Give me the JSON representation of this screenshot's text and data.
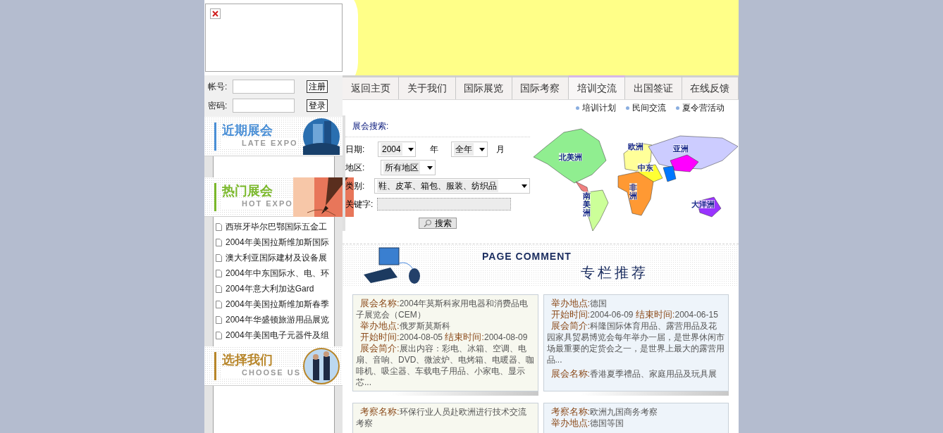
{
  "login": {
    "fields": [
      {
        "label": "帐号:",
        "button": "注册"
      },
      {
        "label": "密码:",
        "button": "登录"
      }
    ]
  },
  "nav": {
    "tabs": [
      {
        "label": "返回主页",
        "selected": false
      },
      {
        "label": "关于我们",
        "selected": false
      },
      {
        "label": "国际展览",
        "selected": false
      },
      {
        "label": "国际考察",
        "selected": false
      },
      {
        "label": "培训交流",
        "selected": true
      },
      {
        "label": "出国签证",
        "selected": false
      },
      {
        "label": "在线反馈",
        "selected": false
      }
    ],
    "subnav": [
      "培训计划",
      "民间交流",
      "夏令营活动"
    ]
  },
  "sidebar": {
    "sections": [
      {
        "title": "近期展会",
        "subtitle": "LATE EXPO",
        "color": "#4a8fd6"
      },
      {
        "title": "热门展会",
        "subtitle": "HOT EXPO",
        "color": "#7ab82a",
        "items": [
          "西班牙毕尔巴鄂国际五金工",
          "2004年美国拉斯维加斯国际",
          "澳大利亚国际建材及设备展",
          "2004年中东国际水、电、环",
          "2004年意大利加达Gard",
          "2004年美国拉斯维加斯春季",
          "2004年华盛顿旅游用品展览",
          "2004年美国电子元器件及组"
        ]
      },
      {
        "title": "选择我们",
        "subtitle": "CHOOSE US",
        "color": "#b8862a"
      }
    ]
  },
  "search": {
    "title": "展会搜索:",
    "date_label": "日期:",
    "year": "2004",
    "year_unit": "年",
    "month": "全年",
    "month_unit": "月",
    "region_label": "地区:",
    "region": "所有地区",
    "category_label": "类别:",
    "category": "鞋、皮革、箱包、服装、纺织品",
    "keyword_label": "关键字:",
    "button": "搜索"
  },
  "map": {
    "regions": [
      {
        "label": "北美洲",
        "color": "#90ee90",
        "kind": "horizontal"
      },
      {
        "label": "南美洲",
        "color": "#ccff99",
        "kind": "vertical"
      },
      {
        "label": "欧洲",
        "color": "#ffff99",
        "kind": "horizontal"
      },
      {
        "label": "亚洲",
        "color": "#ccccff",
        "kind": "horizontal"
      },
      {
        "label": "中东",
        "color": "#ffff33",
        "kind": "horizontal"
      },
      {
        "label": "非洲",
        "color": "#ff9933",
        "kind": "vertical"
      },
      {
        "label": "大洋洲",
        "color": "#9933ff",
        "kind": "horizontal"
      }
    ]
  },
  "banner": {
    "title": "PAGE COMMENT",
    "subtitle": "专栏推荐"
  },
  "cards": [
    {
      "entries": [
        {
          "lines": [
            [
              {
                "label": "展会名称:",
                "value": "2004年莫斯科家用电器和消费品电子展览会（CEM）"
              }
            ],
            [
              {
                "label": "举办地点:",
                "value": "俄罗斯莫斯科"
              }
            ],
            [
              {
                "label": "开始时间:",
                "value": "2004-08-05"
              },
              {
                "label": "结束时间:",
                "value": "2004-08-09"
              }
            ],
            [
              {
                "label": "展会简介:",
                "value": "展出内容：彩电、冰箱、空调、电扇、音响、DVD、微波炉、电烤箱、电暖器、咖啡机、吸尘器、车载电子用品、小家电、显示芯..."
              }
            ]
          ]
        }
      ]
    },
    {
      "entries": [
        {
          "lines": [
            [
              {
                "label": "举办地点:",
                "value": "德国"
              }
            ],
            [
              {
                "label": "开始时间:",
                "value": "2004-06-09"
              },
              {
                "label": "结束时间:",
                "value": "2004-06-15"
              }
            ],
            [
              {
                "label": "展会简介:",
                "value": "科隆国际体育用品、露营用品及花园家具贸易博览会每年举办一届，是世界休闲市场最重要的定货会之一，是世界上最大的露营用品..."
              }
            ]
          ]
        },
        {
          "lines": [
            [
              {
                "label": "展会名称:",
                "value": "香港夏季禮品、家庭用品及玩具展"
              }
            ]
          ]
        }
      ]
    },
    {
      "entries": [
        {
          "lines": [
            [
              {
                "label": "考察名称:",
                "value": "环保行业人员赴欧洲进行技术交流考察"
              }
            ]
          ]
        }
      ]
    },
    {
      "entries": [
        {
          "lines": [
            [
              {
                "label": "考察名称:",
                "value": "欧洲九国商务考察"
              }
            ],
            [
              {
                "label": "举办地点:",
                "value": "德国等国"
              }
            ]
          ]
        }
      ]
    }
  ]
}
